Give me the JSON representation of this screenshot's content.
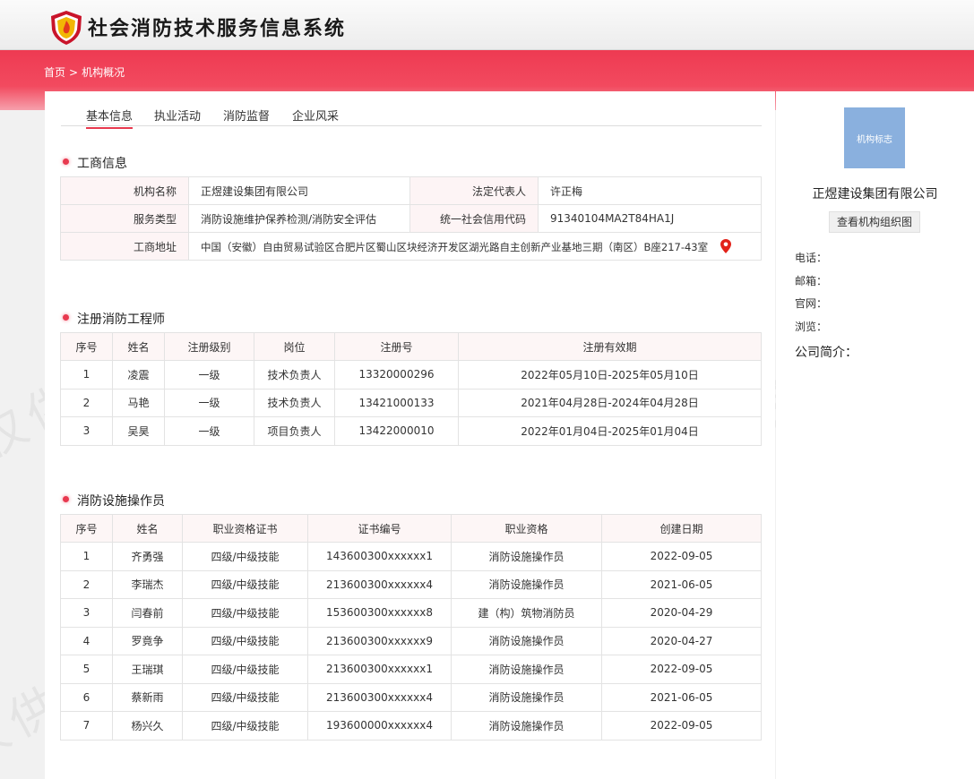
{
  "header": {
    "title": "社会消防技术服务信息系统"
  },
  "breadcrumb": {
    "home": "首页",
    "separator": ">",
    "current": "机构概况"
  },
  "tabs": [
    "基本信息",
    "执业活动",
    "消防监督",
    "企业风采"
  ],
  "business_info": {
    "title": "工商信息",
    "org_name_label": "机构名称",
    "org_name": "正煜建设集团有限公司",
    "legal_rep_label": "法定代表人",
    "legal_rep": "许正梅",
    "service_type_label": "服务类型",
    "service_type": "消防设施维护保养检测/消防安全评估",
    "credit_code_label": "统一社会信用代码",
    "credit_code": "91340104MA2T84HA1J",
    "address_label": "工商地址",
    "address": "中国（安徽）自由贸易试验区合肥片区蜀山区块经济开发区湖光路自主创新产业基地三期（南区）B座217-43室"
  },
  "engineers": {
    "title": "注册消防工程师",
    "columns": [
      "序号",
      "姓名",
      "注册级别",
      "岗位",
      "注册号",
      "注册有效期"
    ],
    "rows": [
      [
        "1",
        "凌震",
        "一级",
        "技术负责人",
        "13320000296",
        "2022年05月10日-2025年05月10日"
      ],
      [
        "2",
        "马艳",
        "一级",
        "技术负责人",
        "13421000133",
        "2021年04月28日-2024年04月28日"
      ],
      [
        "3",
        "吴昊",
        "一级",
        "项目负责人",
        "13422000010",
        "2022年01月04日-2025年01月04日"
      ]
    ]
  },
  "operators": {
    "title": "消防设施操作员",
    "columns": [
      "序号",
      "姓名",
      "职业资格证书",
      "证书编号",
      "职业资格",
      "创建日期"
    ],
    "rows": [
      [
        "1",
        "齐勇强",
        "四级/中级技能",
        "143600300xxxxxx1",
        "消防设施操作员",
        "2022-09-05"
      ],
      [
        "2",
        "李瑞杰",
        "四级/中级技能",
        "213600300xxxxxx4",
        "消防设施操作员",
        "2021-06-05"
      ],
      [
        "3",
        "闫春前",
        "四级/中级技能",
        "153600300xxxxxx8",
        "建（构）筑物消防员",
        "2020-04-29"
      ],
      [
        "4",
        "罗竟争",
        "四级/中级技能",
        "213600300xxxxxx9",
        "消防设施操作员",
        "2020-04-27"
      ],
      [
        "5",
        "王瑞琪",
        "四级/中级技能",
        "213600300xxxxxx1",
        "消防设施操作员",
        "2022-09-05"
      ],
      [
        "6",
        "蔡新雨",
        "四级/中级技能",
        "213600300xxxxxx4",
        "消防设施操作员",
        "2021-06-05"
      ],
      [
        "7",
        "杨兴久",
        "四级/中级技能",
        "193600000xxxxxx4",
        "消防设施操作员",
        "2022-09-05"
      ]
    ]
  },
  "side": {
    "thumb_text": "机构标志",
    "org_name": "正煜建设集团有限公司",
    "org_chart_button": "查看机构组织图",
    "phone_label": "电话：",
    "email_label": "邮箱：",
    "website_label": "官网：",
    "views_label": "浏览：",
    "intro_label": "公司简介："
  },
  "watermark": {
    "text": "仅供微信公众号宣传使用"
  },
  "colors": {
    "accent": "#e8394f",
    "band": "#f24a5f",
    "thumb": "#8ab0de"
  }
}
